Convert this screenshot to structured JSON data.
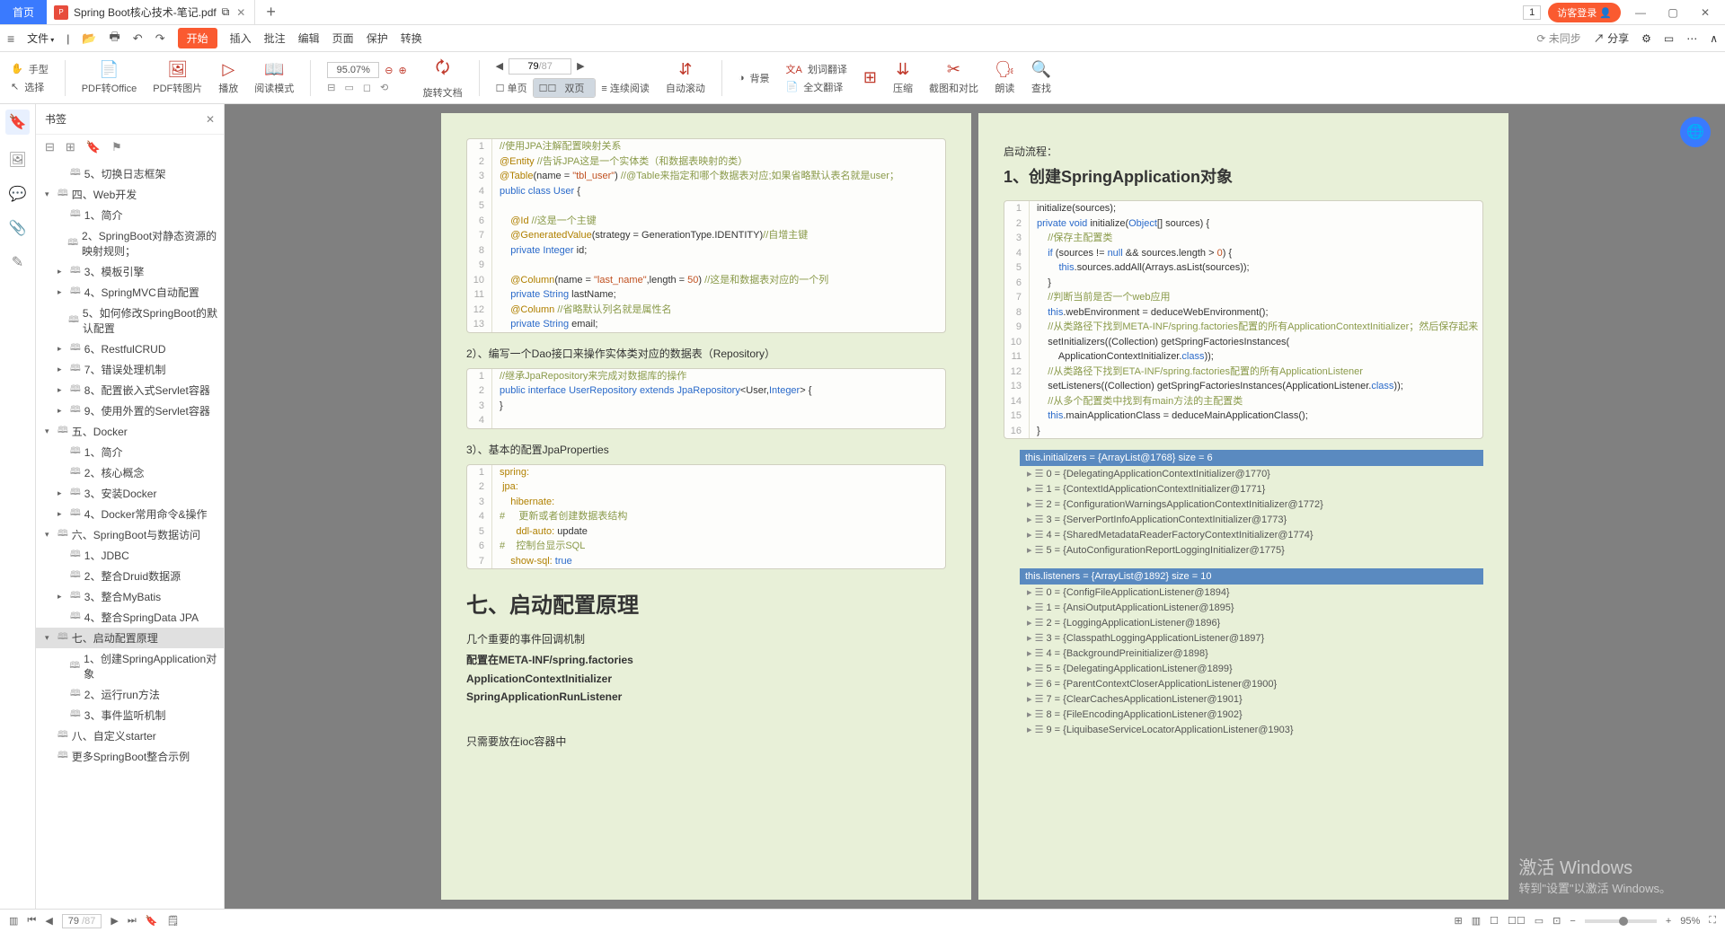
{
  "titlebar": {
    "home": "首页",
    "tab_title": "Spring Boot核心技术-笔记.pdf",
    "box_num": "1",
    "login": "访客登录"
  },
  "menubar": {
    "file": "文件",
    "start": "开始",
    "insert": "插入",
    "annotate": "批注",
    "edit": "编辑",
    "page": "页面",
    "protect": "保护",
    "convert": "转换",
    "not_synced": "未同步",
    "share": "分享"
  },
  "toolbar": {
    "hand": "手型",
    "select": "选择",
    "to_office": "PDF转Office",
    "to_image": "PDF转图片",
    "play": "播放",
    "read_mode": "阅读模式",
    "zoom": "95.07%",
    "rotate": "旋转文档",
    "cur_page": "79",
    "total_page": "/87",
    "single": "单页",
    "double": "双页",
    "continuous": "连续阅读",
    "auto_scroll": "自动滚动",
    "background": "背景",
    "word_translate": "划词翻译",
    "full_translate": "全文翻译",
    "compress": "压缩",
    "crop_compare": "截图和对比",
    "read_aloud": "朗读",
    "find": "查找"
  },
  "bookmark": {
    "title": "书签",
    "items": [
      {
        "lvl": 2,
        "arrow": "",
        "label": "5、切换日志框架"
      },
      {
        "lvl": 1,
        "arrow": "▾",
        "label": "四、Web开发"
      },
      {
        "lvl": 2,
        "arrow": "",
        "label": "1、简介"
      },
      {
        "lvl": 2,
        "arrow": "",
        "label": "2、SpringBoot对静态资源的映射规则；"
      },
      {
        "lvl": 2,
        "arrow": "▸",
        "label": "3、模板引擎"
      },
      {
        "lvl": 2,
        "arrow": "▸",
        "label": "4、SpringMVC自动配置"
      },
      {
        "lvl": 2,
        "arrow": "",
        "label": "5、如何修改SpringBoot的默认配置"
      },
      {
        "lvl": 2,
        "arrow": "▸",
        "label": "6、RestfulCRUD"
      },
      {
        "lvl": 2,
        "arrow": "▸",
        "label": "7、错误处理机制"
      },
      {
        "lvl": 2,
        "arrow": "▸",
        "label": "8、配置嵌入式Servlet容器"
      },
      {
        "lvl": 2,
        "arrow": "▸",
        "label": "9、使用外置的Servlet容器"
      },
      {
        "lvl": 1,
        "arrow": "▾",
        "label": "五、Docker"
      },
      {
        "lvl": 2,
        "arrow": "",
        "label": "1、简介"
      },
      {
        "lvl": 2,
        "arrow": "",
        "label": "2、核心概念"
      },
      {
        "lvl": 2,
        "arrow": "▸",
        "label": "3、安装Docker"
      },
      {
        "lvl": 2,
        "arrow": "▸",
        "label": "4、Docker常用命令&操作"
      },
      {
        "lvl": 1,
        "arrow": "▾",
        "label": "六、SpringBoot与数据访问"
      },
      {
        "lvl": 2,
        "arrow": "",
        "label": "1、JDBC"
      },
      {
        "lvl": 2,
        "arrow": "",
        "label": "2、整合Druid数据源"
      },
      {
        "lvl": 2,
        "arrow": "▸",
        "label": "3、整合MyBatis"
      },
      {
        "lvl": 2,
        "arrow": "",
        "label": "4、整合SpringData JPA"
      },
      {
        "lvl": 1,
        "arrow": "▾",
        "label": "七、启动配置原理",
        "sel": true
      },
      {
        "lvl": 2,
        "arrow": "",
        "label": "1、创建SpringApplication对象"
      },
      {
        "lvl": 2,
        "arrow": "",
        "label": "2、运行run方法"
      },
      {
        "lvl": 2,
        "arrow": "",
        "label": "3、事件监听机制"
      },
      {
        "lvl": 1,
        "arrow": "",
        "label": "八、自定义starter"
      },
      {
        "lvl": 1,
        "arrow": "",
        "label": "更多SpringBoot整合示例"
      }
    ]
  },
  "doc": {
    "left": {
      "code1": [
        {
          "n": "1",
          "html": "<span class='cm'>//使用JPA注解配置映射关系</span>"
        },
        {
          "n": "2",
          "html": "<span class='an'>@Entity</span> <span class='cm'>//告诉JPA这是一个实体类（和数据表映射的类）</span>"
        },
        {
          "n": "3",
          "html": "<span class='an'>@Table</span>(name = <span class='st'>\"tbl_user\"</span>) <span class='cm'>//@Table来指定和哪个数据表对应;如果省略默认表名就是user；</span>"
        },
        {
          "n": "4",
          "html": "<span class='kw'>public class</span> <span class='ty'>User</span> {"
        },
        {
          "n": "5",
          "html": ""
        },
        {
          "n": "6",
          "html": "    <span class='an'>@Id</span> <span class='cm'>//这是一个主键</span>"
        },
        {
          "n": "7",
          "html": "    <span class='an'>@GeneratedValue</span>(strategy = GenerationType.IDENTITY)<span class='cm'>//自增主键</span>"
        },
        {
          "n": "8",
          "html": "    <span class='kw'>private</span> <span class='ty'>Integer</span> id;"
        },
        {
          "n": "9",
          "html": ""
        },
        {
          "n": "10",
          "html": "    <span class='an'>@Column</span>(name = <span class='st'>\"last_name\"</span>,length = <span class='st'>50</span>) <span class='cm'>//这是和数据表对应的一个列</span>"
        },
        {
          "n": "11",
          "html": "    <span class='kw'>private</span> <span class='ty'>String</span> lastName;"
        },
        {
          "n": "12",
          "html": "    <span class='an'>@Column</span> <span class='cm'>//省略默认列名就是属性名</span>"
        },
        {
          "n": "13",
          "html": "    <span class='kw'>private</span> <span class='ty'>String</span> email;"
        }
      ],
      "p1": "2）、编写一个Dao接口来操作实体类对应的数据表（Repository）",
      "code2": [
        {
          "n": "1",
          "html": "<span class='cm'>//继承JpaRepository来完成对数据库的操作</span>"
        },
        {
          "n": "2",
          "html": "<span class='kw'>public interface</span> <span class='ty'>UserRepository</span> <span class='kw'>extends</span> <span class='ty'>JpaRepository</span>&lt;User,<span class='ty'>Integer</span>&gt; {"
        },
        {
          "n": "3",
          "html": "}"
        },
        {
          "n": "4",
          "html": ""
        }
      ],
      "p2": "3）、基本的配置JpaProperties",
      "code3": [
        {
          "n": "1",
          "html": "<span class='an'>spring:</span>"
        },
        {
          "n": "2",
          "html": " <span class='an'>jpa:</span>"
        },
        {
          "n": "3",
          "html": "    <span class='an'>hibernate:</span>"
        },
        {
          "n": "4",
          "html": "<span class='cm'>#     更新或者创建数据表结构</span>"
        },
        {
          "n": "5",
          "html": "      <span class='an'>ddl-auto:</span> update"
        },
        {
          "n": "6",
          "html": "<span class='cm'>#    控制台显示SQL</span>"
        },
        {
          "n": "7",
          "html": "    <span class='an'>show-sql:</span> <span class='kw'>true</span>"
        }
      ],
      "h2": "七、启动配置原理",
      "lines": [
        "几个重要的事件回调机制",
        "配置在META-INF/spring.factories",
        "ApplicationContextInitializer",
        "SpringApplicationRunListener",
        "只需要放在ioc容器中"
      ]
    },
    "right": {
      "p0": "启动流程：",
      "h3": "1、创建SpringApplication对象",
      "code": [
        {
          "n": "1",
          "html": "initialize(sources);"
        },
        {
          "n": "2",
          "html": "<span class='kw'>private void</span> initialize(<span class='ty'>Object</span>[] sources) {"
        },
        {
          "n": "3",
          "html": "    <span class='cm'>//保存主配置类</span>"
        },
        {
          "n": "4",
          "html": "    <span class='kw'>if</span> (sources != <span class='kw'>null</span> &amp;&amp; sources.length &gt; <span class='st'>0</span>) {"
        },
        {
          "n": "5",
          "html": "        <span class='kw'>this</span>.sources.addAll(Arrays.asList(sources));"
        },
        {
          "n": "6",
          "html": "    }"
        },
        {
          "n": "7",
          "html": "    <span class='cm'>//判断当前是否一个web应用</span>"
        },
        {
          "n": "8",
          "html": "    <span class='kw'>this</span>.webEnvironment = deduceWebEnvironment();"
        },
        {
          "n": "9",
          "html": "    <span class='cm'>//从类路径下找到META-INF/spring.factories配置的所有ApplicationContextInitializer；然后保存起来</span>"
        },
        {
          "n": "10",
          "html": "    setInitializers((Collection) getSpringFactoriesInstances("
        },
        {
          "n": "11",
          "html": "        ApplicationContextInitializer.<span class='kw'>class</span>));"
        },
        {
          "n": "12",
          "html": "    <span class='cm'>//从类路径下找到ETA-INF/spring.factories配置的所有ApplicationListener</span>"
        },
        {
          "n": "13",
          "html": "    setListeners((Collection) getSpringFactoriesInstances(ApplicationListener.<span class='kw'>class</span>));"
        },
        {
          "n": "14",
          "html": "    <span class='cm'>//从多个配置类中找到有main方法的主配置类</span>"
        },
        {
          "n": "15",
          "html": "    <span class='kw'>this</span>.mainApplicationClass = deduceMainApplicationClass();"
        },
        {
          "n": "16",
          "html": "}"
        }
      ],
      "debug1_head": "this.initializers = {ArrayList@1768}  size = 6",
      "debug1": [
        "0 = {DelegatingApplicationContextInitializer@1770}",
        "1 = {ContextIdApplicationContextInitializer@1771}",
        "2 = {ConfigurationWarningsApplicationContextInitializer@1772}",
        "3 = {ServerPortInfoApplicationContextInitializer@1773}",
        "4 = {SharedMetadataReaderFactoryContextInitializer@1774}",
        "5 = {AutoConfigurationReportLoggingInitializer@1775}"
      ],
      "debug2_head": "this.listeners = {ArrayList@1892}  size = 10",
      "debug2": [
        "0 = {ConfigFileApplicationListener@1894}",
        "1 = {AnsiOutputApplicationListener@1895}",
        "2 = {LoggingApplicationListener@1896}",
        "3 = {ClasspathLoggingApplicationListener@1897}",
        "4 = {BackgroundPreinitializer@1898}",
        "5 = {DelegatingApplicationListener@1899}",
        "6 = {ParentContextCloserApplicationListener@1900}",
        "7 = {ClearCachesApplicationListener@1901}",
        "8 = {FileEncodingApplicationListener@1902}",
        "9 = {LiquibaseServiceLocatorApplicationListener@1903}"
      ]
    }
  },
  "statusbar": {
    "page_cur": "79",
    "page_tot": " /87",
    "zoom": "95%"
  },
  "watermark": {
    "l1": "激活 Windows",
    "l2": "转到\"设置\"以激活 Windows。"
  }
}
